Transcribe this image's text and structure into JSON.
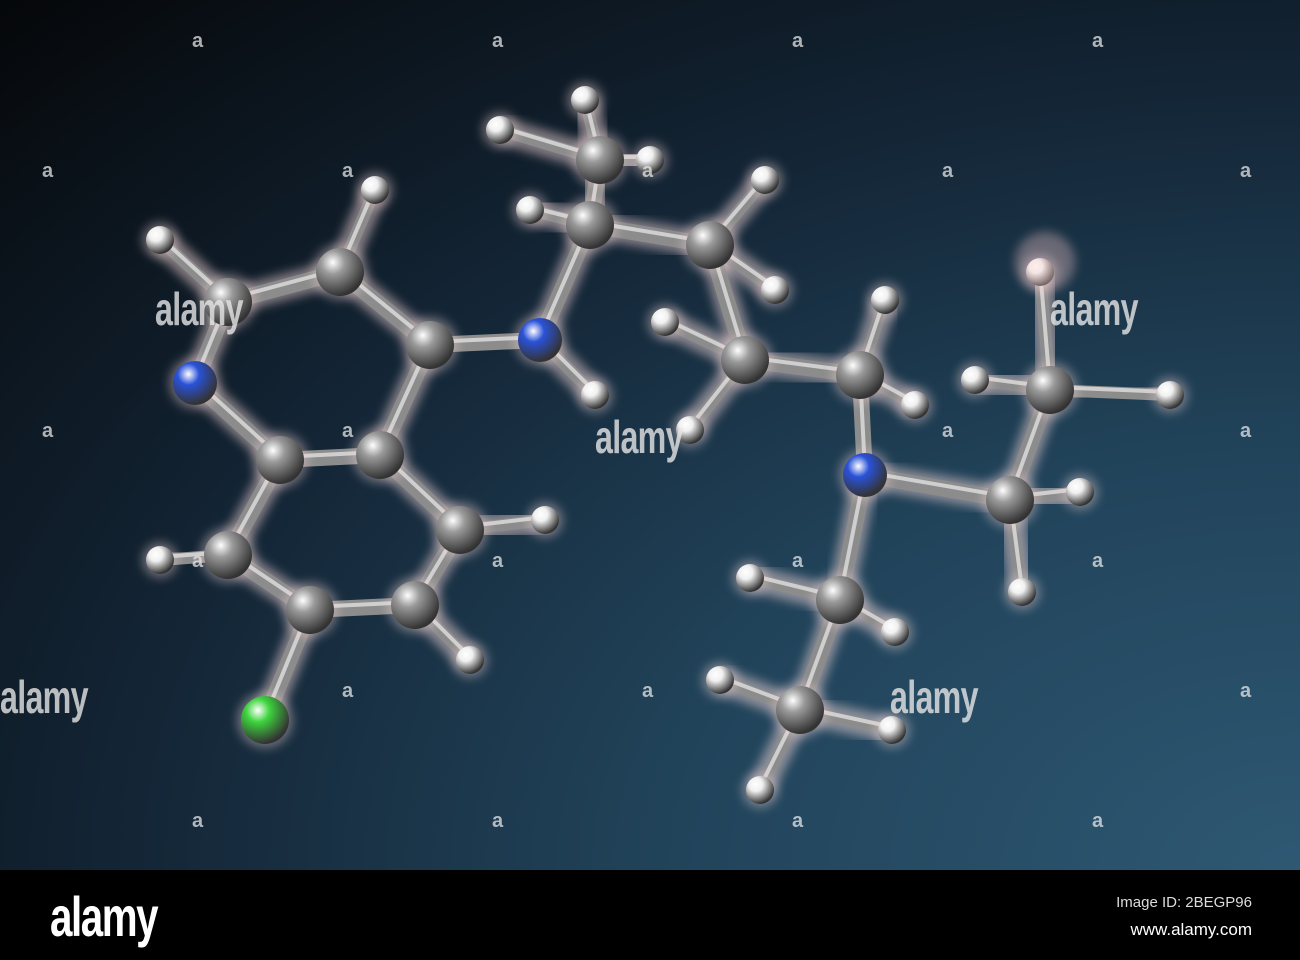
{
  "watermark": {
    "text": "alamy",
    "mark": "a"
  },
  "footer": {
    "logo": "alamy",
    "image_id": "Image ID: 2BEGP96",
    "url": "www.alamy.com"
  },
  "colors": {
    "carbon": "#9a9a9a",
    "hydrogen": "#f0f0f0",
    "nitrogen": "#2a52d8",
    "chlorine": "#3ed43e"
  }
}
